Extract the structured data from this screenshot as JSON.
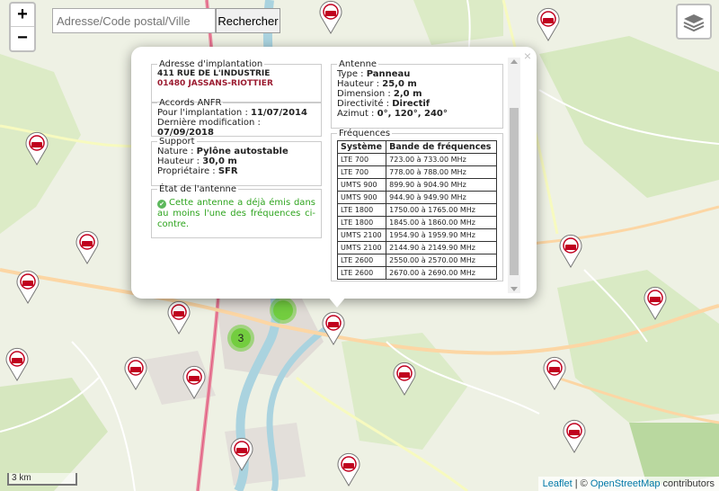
{
  "map": {
    "search_placeholder": "Adresse/Code postal/Ville",
    "search_button": "Rechercher",
    "zoom_in": "+",
    "zoom_out": "−",
    "layers_icon": "layers-icon",
    "cluster_count": "3",
    "scale_label": "3 km",
    "attribution": {
      "leaflet": "Leaflet",
      "sep": " | © ",
      "osm": "OpenStreetMap",
      "tail": " contributors"
    },
    "marker_icon": "free-4g-antenna-marker-icon"
  },
  "popup": {
    "close": "×",
    "adresse": {
      "legend": "Adresse d'implantation",
      "line1": "411 RUE DE L'INDUSTRIE",
      "line2": "01480 JASSANS-RIOTTIER"
    },
    "anfr": {
      "legend": "Accords ANFR",
      "implantation_label": "Pour l'implantation : ",
      "implantation_value": "11/07/2014",
      "modification_label": "Dernière modification : ",
      "modification_value": "07/09/2018"
    },
    "support": {
      "legend": "Support",
      "nature_label": "Nature : ",
      "nature_value": "Pylône autostable",
      "hauteur_label": "Hauteur : ",
      "hauteur_value": "30,0 m",
      "proprietaire_label": "Propriétaire : ",
      "proprietaire_value": "SFR"
    },
    "etat": {
      "legend": "État de l'antenne",
      "text": "Cette antenne a déjà émis dans au moins l'une des fréquences ci-contre."
    },
    "antenne": {
      "legend": "Antenne",
      "type_label": "Type : ",
      "type_value": "Panneau",
      "hauteur_label": "Hauteur : ",
      "hauteur_value": "25,0 m",
      "dimension_label": "Dimension : ",
      "dimension_value": "2,0 m",
      "directivite_label": "Directivité : ",
      "directivite_value": "Directif",
      "azimut_label": "Azimut : ",
      "azimut_value": "0°, 120°, 240°"
    },
    "frequences": {
      "legend": "Fréquences",
      "headers": [
        "Système",
        "Bande de fréquences"
      ],
      "rows": [
        [
          "LTE 700",
          "723.00 à 733.00 MHz"
        ],
        [
          "LTE 700",
          "778.00 à 788.00 MHz"
        ],
        [
          "UMTS 900",
          "899.90 à 904.90 MHz"
        ],
        [
          "UMTS 900",
          "944.90 à 949.90 MHz"
        ],
        [
          "LTE 1800",
          "1750.00 à 1765.00 MHz"
        ],
        [
          "LTE 1800",
          "1845.00 à 1860.00 MHz"
        ],
        [
          "UMTS 2100",
          "1954.90 à 1959.90 MHz"
        ],
        [
          "UMTS 2100",
          "2144.90 à 2149.90 MHz"
        ],
        [
          "LTE 2600",
          "2550.00 à 2570.00 MHz"
        ],
        [
          "LTE 2600",
          "2670.00 à 2690.00 MHz"
        ]
      ]
    }
  }
}
